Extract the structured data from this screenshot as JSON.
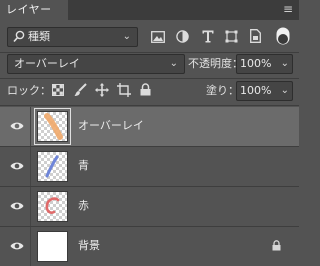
{
  "panel": {
    "tab_label": "レイヤー",
    "menu_glyph": "≡"
  },
  "filter": {
    "kind_label": "種類"
  },
  "blend": {
    "mode": "オーバーレイ",
    "opacity_label": "不透明度：",
    "opacity_value": "100%"
  },
  "lock_bar": {
    "lock_label": "ロック：",
    "fill_label": "塗り：",
    "fill_value": "100%"
  },
  "layers": [
    {
      "name": "オーバーレイ",
      "selected": true,
      "stroke_color": "#f0a96a"
    },
    {
      "name": "青",
      "selected": false,
      "stroke_color": "#6f86d9"
    },
    {
      "name": "赤",
      "selected": false,
      "stroke_color": "#e06a6a"
    },
    {
      "name": "背景",
      "selected": false,
      "locked": true
    }
  ]
}
